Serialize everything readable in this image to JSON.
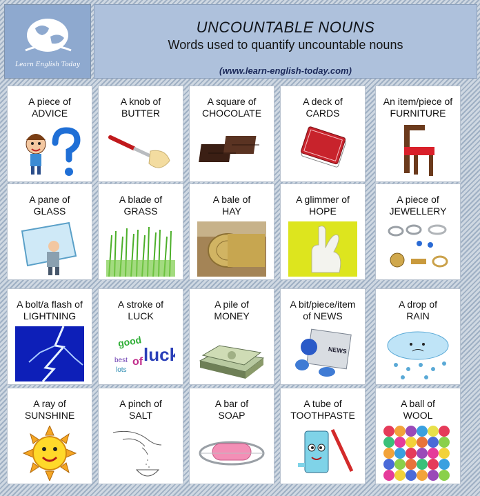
{
  "logo": {
    "text": "Learn English Today"
  },
  "header": {
    "title": "UNCOUNTABLE NOUNS",
    "subtitle": "Words used to quantify uncountable nouns",
    "url": "(www.learn-english-today.com)"
  },
  "cells": [
    {
      "line1": "A piece of",
      "line2": "ADVICE",
      "icon": "boy-question-icon"
    },
    {
      "line1": "A knob of",
      "line2": "BUTTER",
      "icon": "butter-knife-icon"
    },
    {
      "line1": "A square of",
      "line2": "CHOCOLATE",
      "icon": "chocolate-icon"
    },
    {
      "line1": "A deck of",
      "line2": "CARDS",
      "icon": "cards-icon"
    },
    {
      "line1": "An item/piece of",
      "line2": "FURNITURE",
      "icon": "chair-icon"
    },
    {
      "line1": "A pane of",
      "line2": "GLASS",
      "icon": "glass-pane-icon"
    },
    {
      "line1": "A blade of",
      "line2": "GRASS",
      "icon": "grass-icon"
    },
    {
      "line1": "A bale of",
      "line2": "HAY",
      "icon": "hay-bale-icon"
    },
    {
      "line1": "A glimmer of",
      "line2": "HOPE",
      "icon": "crossed-fingers-icon"
    },
    {
      "line1": "A piece of",
      "line2": "JEWELLERY",
      "icon": "jewellery-icon"
    },
    {
      "line1": "A bolt/a flash of",
      "line2": "LIGHTNING",
      "icon": "lightning-icon"
    },
    {
      "line1": "A stroke of",
      "line2": "LUCK",
      "icon": "good-luck-icon",
      "art": {
        "a": "good",
        "b": "luck",
        "c": "best",
        "d": "of",
        "e": "lots"
      }
    },
    {
      "line1": "A pile of",
      "line2": "MONEY",
      "icon": "money-pile-icon"
    },
    {
      "line1": "A bit/piece/item",
      "line2": "of NEWS",
      "icon": "newspaper-icon",
      "art": {
        "a": "NEWS"
      }
    },
    {
      "line1": "A drop of",
      "line2": "RAIN",
      "icon": "rain-cloud-icon"
    },
    {
      "line1": "A ray of",
      "line2": "SUNSHINE",
      "icon": "sun-icon"
    },
    {
      "line1": "A pinch of",
      "line2": "SALT",
      "icon": "salt-pinch-icon"
    },
    {
      "line1": "A bar of",
      "line2": "SOAP",
      "icon": "soap-icon"
    },
    {
      "line1": "A tube of",
      "line2": "TOOTHPASTE",
      "icon": "toothpaste-icon"
    },
    {
      "line1": "A ball of",
      "line2": "WOOL",
      "icon": "wool-icon"
    }
  ]
}
